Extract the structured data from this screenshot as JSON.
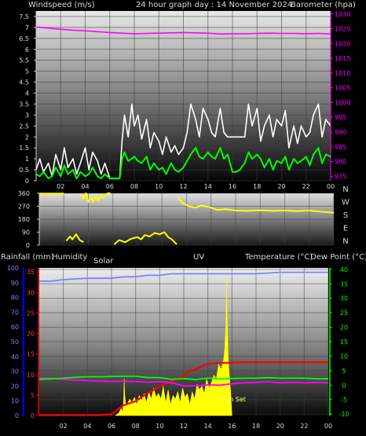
{
  "colors": {
    "bg": "#000000",
    "wind_avg": "#00ff00",
    "wind_gust": "#ffffff",
    "barometer": "#ff00ff",
    "direction": "#ffff00",
    "rain": "#ff0000",
    "humidity": "#00ff00",
    "solar": "#ffff00",
    "temperature": "#ff00ff",
    "dewpoint": "#8080ff",
    "axis_left": "#d0d0d0",
    "axis_baro": "#ff00ff",
    "axis_rain": "#ff0000",
    "axis_hum": "#0000ff",
    "axis_temp": "#00ff00"
  },
  "x_ticks": [
    "02",
    "04",
    "06",
    "08",
    "10",
    "12",
    "14",
    "16",
    "18",
    "20",
    "22",
    "00"
  ],
  "chart_data": [
    {
      "type": "line",
      "title": "24 hour graph day : 14 November 2024",
      "ylabel": "Windspeed (m/s)",
      "ylabel_right": "Barometer (hpa)",
      "y_ticks": [
        "0",
        "0.5",
        "1",
        "1.5",
        "2",
        "2.5",
        "3",
        "3.5",
        "4",
        "4.5",
        "5",
        "5.5",
        "6",
        "6.5",
        "7",
        "7.5"
      ],
      "y_ticks_right": [
        "975",
        "980",
        "985",
        "990",
        "995",
        "1000",
        "1005",
        "1010",
        "1015",
        "1020",
        "1025",
        "1030"
      ],
      "ylim": [
        0,
        7.75
      ],
      "ylim_right": [
        973.5,
        1031
      ],
      "xlim": [
        0,
        24
      ],
      "series": [
        {
          "key": "barometer",
          "x": [
            0,
            1,
            2,
            3,
            4,
            5,
            6,
            7,
            8,
            9,
            10,
            11,
            12,
            13,
            14,
            15,
            16,
            17,
            18,
            19,
            20,
            21,
            22,
            23,
            24
          ],
          "values": [
            1025.6,
            1025.2,
            1024.8,
            1024.5,
            1024.3,
            1024.0,
            1023.7,
            1023.5,
            1023.3,
            1023.4,
            1023.5,
            1023.6,
            1023.7,
            1023.6,
            1023.5,
            1023.2,
            1023.3,
            1023.3,
            1023.4,
            1023.5,
            1023.4,
            1023.4,
            1023.3,
            1023.4,
            1023.2
          ]
        },
        {
          "key": "wind_gust",
          "x": [
            0,
            0.3,
            0.6,
            1,
            1.3,
            1.6,
            2,
            2.3,
            2.6,
            3,
            3.3,
            3.6,
            4,
            4.3,
            4.6,
            5,
            5.3,
            5.6,
            6,
            6.4,
            6.8,
            7,
            7.2,
            7.5,
            7.8,
            8,
            8.3,
            8.6,
            9,
            9.3,
            9.6,
            10,
            10.3,
            10.6,
            11,
            11.3,
            11.6,
            12,
            12.3,
            12.6,
            13,
            13.3,
            13.6,
            14,
            14.3,
            14.6,
            15,
            15.3,
            15.6,
            16,
            16.3,
            16.6,
            17,
            17.3,
            17.6,
            18,
            18.3,
            18.6,
            19,
            19.3,
            19.6,
            20,
            20.3,
            20.6,
            21,
            21.3,
            21.6,
            22,
            22.3,
            22.6,
            23,
            23.3,
            23.6,
            24
          ],
          "values": [
            0.5,
            1.0,
            0.4,
            0.8,
            0.2,
            1.2,
            0.5,
            1.5,
            0.6,
            1.0,
            0.3,
            0.8,
            1.5,
            0.5,
            1.3,
            0.9,
            0.3,
            0.8,
            0.1,
            0.1,
            0.1,
            1.8,
            3.0,
            2.0,
            3.5,
            2.5,
            3.0,
            1.9,
            2.8,
            1.5,
            2.2,
            1.8,
            1.2,
            2.0,
            1.3,
            1.6,
            1.2,
            1.5,
            2.2,
            3.5,
            2.8,
            2.0,
            3.3,
            2.8,
            2.2,
            2.0,
            3.3,
            2.2,
            2.0,
            2.0,
            2.0,
            2.0,
            2.0,
            3.5,
            2.5,
            3.3,
            1.8,
            2.5,
            3.0,
            2.0,
            2.8,
            2.5,
            3.2,
            1.5,
            2.5,
            1.7,
            2.5,
            2.0,
            2.2,
            3.0,
            3.5,
            2.0,
            2.8,
            2.5
          ]
        },
        {
          "key": "wind_avg",
          "x": [
            0,
            0.3,
            0.6,
            1,
            1.3,
            1.6,
            2,
            2.3,
            2.6,
            3,
            3.3,
            3.6,
            4,
            4.3,
            4.6,
            5,
            5.3,
            5.6,
            6,
            6.4,
            6.8,
            7,
            7.2,
            7.5,
            7.8,
            8,
            8.3,
            8.6,
            9,
            9.3,
            9.6,
            10,
            10.3,
            10.6,
            11,
            11.3,
            11.6,
            12,
            12.3,
            12.6,
            13,
            13.3,
            13.6,
            14,
            14.3,
            14.6,
            15,
            15.3,
            15.6,
            16,
            16.3,
            16.6,
            17,
            17.3,
            17.6,
            18,
            18.3,
            18.6,
            19,
            19.3,
            19.6,
            20,
            20.3,
            20.6,
            21,
            21.3,
            21.6,
            22,
            22.3,
            22.6,
            23,
            23.3,
            23.6,
            24
          ],
          "values": [
            0.3,
            0.2,
            0.4,
            0.1,
            0.2,
            0.6,
            0.2,
            0.7,
            0.3,
            0.5,
            0.1,
            0.4,
            0.2,
            0.3,
            0.6,
            0.2,
            0.1,
            0.3,
            0.1,
            0.1,
            0.1,
            1.0,
            1.3,
            0.9,
            1.0,
            1.1,
            0.9,
            0.8,
            1.1,
            0.5,
            0.8,
            0.5,
            0.6,
            0.3,
            0.8,
            0.5,
            0.4,
            0.6,
            0.9,
            1.2,
            1.5,
            1.1,
            1.0,
            1.3,
            1.1,
            1.0,
            1.5,
            1.0,
            1.2,
            0.4,
            0.4,
            0.5,
            0.8,
            1.3,
            1.0,
            1.2,
            1.0,
            0.6,
            1.0,
            0.5,
            0.9,
            0.8,
            1.1,
            0.5,
            1.0,
            0.8,
            0.9,
            1.1,
            0.7,
            1.2,
            1.5,
            0.8,
            1.2,
            1.1
          ]
        }
      ]
    },
    {
      "type": "line",
      "ylabel": "Wind direction",
      "y_ticks": [
        "0",
        "90",
        "180",
        "270",
        "360"
      ],
      "y_ticks_right": [
        "N",
        "W",
        "S",
        "E",
        "N"
      ],
      "ylim": [
        0,
        360
      ],
      "xlim": [
        0,
        24
      ],
      "series": [
        {
          "key": "direction_a",
          "x": [
            0,
            0.5,
            1,
            1.5,
            2
          ],
          "values": [
            358,
            358,
            358,
            358,
            358
          ]
        },
        {
          "key": "direction_b",
          "x": [
            3.4,
            3.6,
            3.8,
            4.0,
            4.2,
            4.4,
            4.6,
            4.8,
            5.0,
            5.2,
            5.4,
            5.6,
            5.8
          ],
          "values": [
            350,
            320,
            360,
            300,
            330,
            300,
            340,
            310,
            345,
            325,
            350,
            360,
            360
          ]
        },
        {
          "key": "direction_c",
          "x": [
            2.2,
            2.5,
            2.7,
            3.0,
            3.3,
            3.6
          ],
          "values": [
            30,
            60,
            40,
            75,
            35,
            20
          ]
        },
        {
          "key": "direction_d",
          "x": [
            6.1,
            6.5,
            7.0,
            7.5,
            8.0,
            8.3,
            8.6,
            9.0,
            9.4,
            9.8,
            10.2,
            10.5,
            10.8,
            11.2
          ],
          "values": [
            5,
            35,
            20,
            45,
            55,
            40,
            70,
            60,
            85,
            75,
            90,
            55,
            40,
            5
          ]
        },
        {
          "key": "direction_e",
          "x": [
            11.3,
            11.7,
            12.2,
            12.7,
            13.2,
            13.8,
            14.5,
            15.2,
            16,
            17,
            18,
            19,
            20,
            21,
            22,
            23,
            24
          ],
          "values": [
            330,
            290,
            270,
            260,
            275,
            265,
            245,
            250,
            240,
            238,
            242,
            238,
            240,
            236,
            240,
            232,
            225
          ]
        }
      ]
    },
    {
      "type": "line",
      "y_labels": [
        "Rainfall (mm)",
        "Humidity",
        "Solar",
        "UV",
        "Temperature (°C)",
        "Dew Point (°C)"
      ],
      "annotation": "Sun Set",
      "y_ticks_rain": [
        "0",
        "5",
        "10",
        "15",
        "20",
        "25",
        "30",
        "35"
      ],
      "y_ticks_hum": [
        "0",
        "10",
        "20",
        "30",
        "40",
        "50",
        "60",
        "70",
        "80",
        "90",
        "100"
      ],
      "y_ticks_temp": [
        "-10",
        "-5",
        "0",
        "5",
        "10",
        "15",
        "20",
        "25",
        "30",
        "35",
        "40"
      ],
      "ylim_rain": [
        0,
        36
      ],
      "ylim_hum": [
        0,
        100
      ],
      "ylim_temp": [
        -10.5,
        40.5
      ],
      "xlim": [
        0,
        24
      ],
      "series": [
        {
          "key": "rainfall",
          "x": [
            0,
            1,
            2,
            3,
            4,
            5,
            6,
            6.5,
            7,
            7.5,
            8,
            8.5,
            9,
            9.5,
            10,
            10.5,
            11,
            11.5,
            12,
            12.5,
            13,
            13.5,
            14,
            15,
            16,
            17,
            18,
            19,
            20,
            21,
            22,
            23,
            24
          ],
          "values": [
            0.1,
            0.1,
            0.1,
            0.1,
            0.1,
            0.1,
            0.3,
            1.5,
            2.5,
            3.0,
            3.5,
            4.5,
            5.5,
            6.2,
            7.2,
            7.8,
            8.3,
            9.0,
            9.8,
            10.8,
            11.3,
            12.0,
            12.6,
            12.8,
            12.9,
            13.0,
            13.0,
            13.0,
            13.0,
            13.0,
            13.0,
            13.0,
            13.0
          ]
        },
        {
          "key": "humidity",
          "x": [
            0,
            1,
            2,
            4,
            6,
            7,
            8,
            9,
            10,
            11,
            12,
            13,
            14,
            16,
            18,
            20,
            22,
            24
          ],
          "values": [
            91,
            91,
            92,
            93,
            93,
            94,
            94,
            95,
            95,
            96,
            96,
            96,
            96,
            96,
            96,
            97,
            97,
            97
          ]
        },
        {
          "key": "temperature",
          "x": [
            0,
            1,
            2,
            3,
            4,
            5,
            6,
            7,
            8,
            9,
            10,
            11,
            12,
            13,
            14,
            15,
            16,
            17,
            18,
            19,
            20,
            21,
            22,
            23,
            24
          ],
          "values": [
            2.5,
            2.3,
            2.0,
            1.8,
            1.6,
            1.4,
            1.3,
            1.3,
            1.3,
            1.0,
            1.2,
            0.8,
            -0.3,
            -0.2,
            0.1,
            0.0,
            0.5,
            0.8,
            1.0,
            1.2,
            0.8,
            1.0,
            0.8,
            1.0,
            0.8
          ]
        },
        {
          "key": "dewpoint",
          "x": [
            0,
            1,
            2,
            3,
            4,
            5,
            6,
            7,
            8,
            9,
            10,
            11,
            12,
            13,
            14,
            15,
            16,
            17,
            18,
            19,
            20,
            21,
            22,
            23,
            24
          ],
          "values": [
            2.0,
            2.2,
            2.4,
            2.7,
            2.9,
            2.9,
            3.0,
            3.1,
            3.1,
            2.6,
            2.6,
            2.0,
            2.3,
            1.9,
            2.5,
            2.2,
            2.3,
            2.4,
            2.4,
            2.6,
            2.4,
            2.4,
            2.4,
            2.2,
            2.2
          ]
        },
        {
          "key": "solar",
          "x": [
            6.3,
            6.6,
            6.8,
            6.9,
            7.0,
            7.05,
            7.1,
            7.2,
            7.3,
            7.5,
            7.7,
            7.9,
            8.1,
            8.3,
            8.5,
            8.7,
            8.9,
            9.1,
            9.3,
            9.5,
            9.7,
            9.9,
            10.1,
            10.3,
            10.5,
            10.7,
            10.9,
            11.1,
            11.3,
            11.5,
            11.7,
            11.9,
            12.1,
            12.3,
            12.5,
            12.7,
            12.9,
            13.1,
            13.3,
            13.5,
            13.7,
            13.9,
            14.1,
            14.3,
            14.5,
            14.7,
            14.9,
            15.1,
            15.3,
            15.4,
            15.5,
            15.55,
            15.6,
            15.7,
            15.8,
            15.9,
            16.0
          ],
          "values": [
            0,
            3,
            8,
            4,
            15,
            40,
            22,
            10,
            12,
            18,
            14,
            20,
            12,
            22,
            16,
            24,
            14,
            26,
            18,
            30,
            20,
            24,
            18,
            32,
            14,
            28,
            12,
            22,
            18,
            26,
            14,
            30,
            20,
            24,
            12,
            26,
            18,
            34,
            28,
            32,
            24,
            40,
            30,
            36,
            44,
            40,
            56,
            50,
            60,
            72,
            100,
            150,
            110,
            60,
            40,
            25,
            0
          ]
        }
      ]
    }
  ]
}
